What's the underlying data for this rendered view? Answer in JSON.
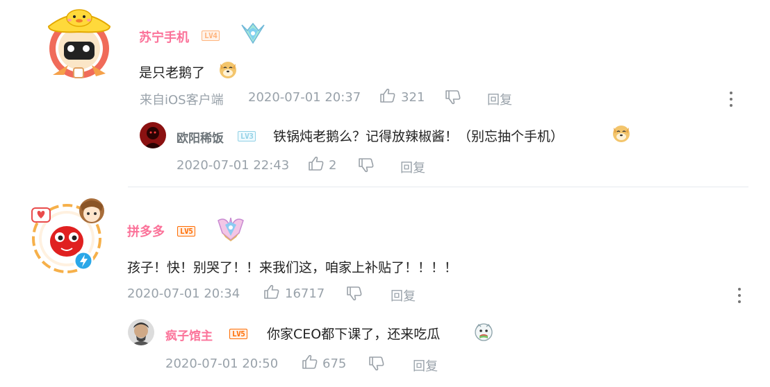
{
  "comments": [
    {
      "user": "苏宁手机",
      "level": "LV4",
      "text": "是只老鹅了",
      "emoji": "doge",
      "source": "来自iOS客户端",
      "time": "2020-07-01 20:37",
      "likes": "321",
      "reply_label": "回复",
      "replies": [
        {
          "user": "欧阳稀饭",
          "level": "LV3",
          "text": "铁锅炖老鹅么？记得放辣椒酱！（别忘抽个手机）",
          "emoji": "doge",
          "time": "2020-07-01 22:43",
          "likes": "2",
          "reply_label": "回复"
        }
      ]
    },
    {
      "user": "拼多多",
      "level": "LV5",
      "text": "孩子！快！别哭了！！来我们这，咱家上补贴了！！！！",
      "time": "2020-07-01 20:34",
      "likes": "16717",
      "reply_label": "回复",
      "replies": [
        {
          "user": "疯子馆主",
          "level": "LV5",
          "text": "你家CEO都下课了，还来吃瓜",
          "emoji": "eating-melon",
          "time": "2020-07-01 20:50",
          "likes": "675",
          "reply_label": "回复"
        }
      ]
    }
  ],
  "colors": {
    "vip_name": "#fb7299",
    "plain_name": "#6d757a",
    "meta": "#99a2aa",
    "text": "#222222",
    "divider": "#e5e9ef"
  },
  "icons": [
    "like-icon",
    "dislike-icon",
    "more-icon",
    "doge-emoji",
    "medal-badge"
  ]
}
